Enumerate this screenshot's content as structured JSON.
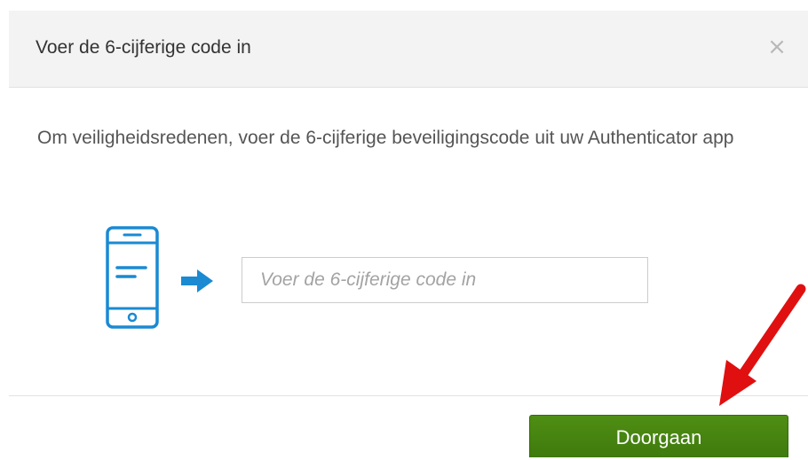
{
  "dialog": {
    "title": "Voer de 6-cijferige code in",
    "close_label": "×",
    "instruction": "Om veiligheidsredenen, voer de 6-cijferige beveiligingscode uit uw Authenticator app",
    "code_input": {
      "value": "",
      "placeholder": "Voer de 6-cijferige code in"
    },
    "continue_label": "Doorgaan"
  },
  "icons": {
    "phone": "mobile-phone-icon",
    "arrow": "arrow-right-icon",
    "close": "close-icon",
    "annotation": "red-annotation-arrow"
  },
  "colors": {
    "header_bg": "#f3f3f3",
    "accent_blue": "#1a8ad3",
    "button_green": "#4a8a12",
    "annotation_red": "#e01010"
  }
}
